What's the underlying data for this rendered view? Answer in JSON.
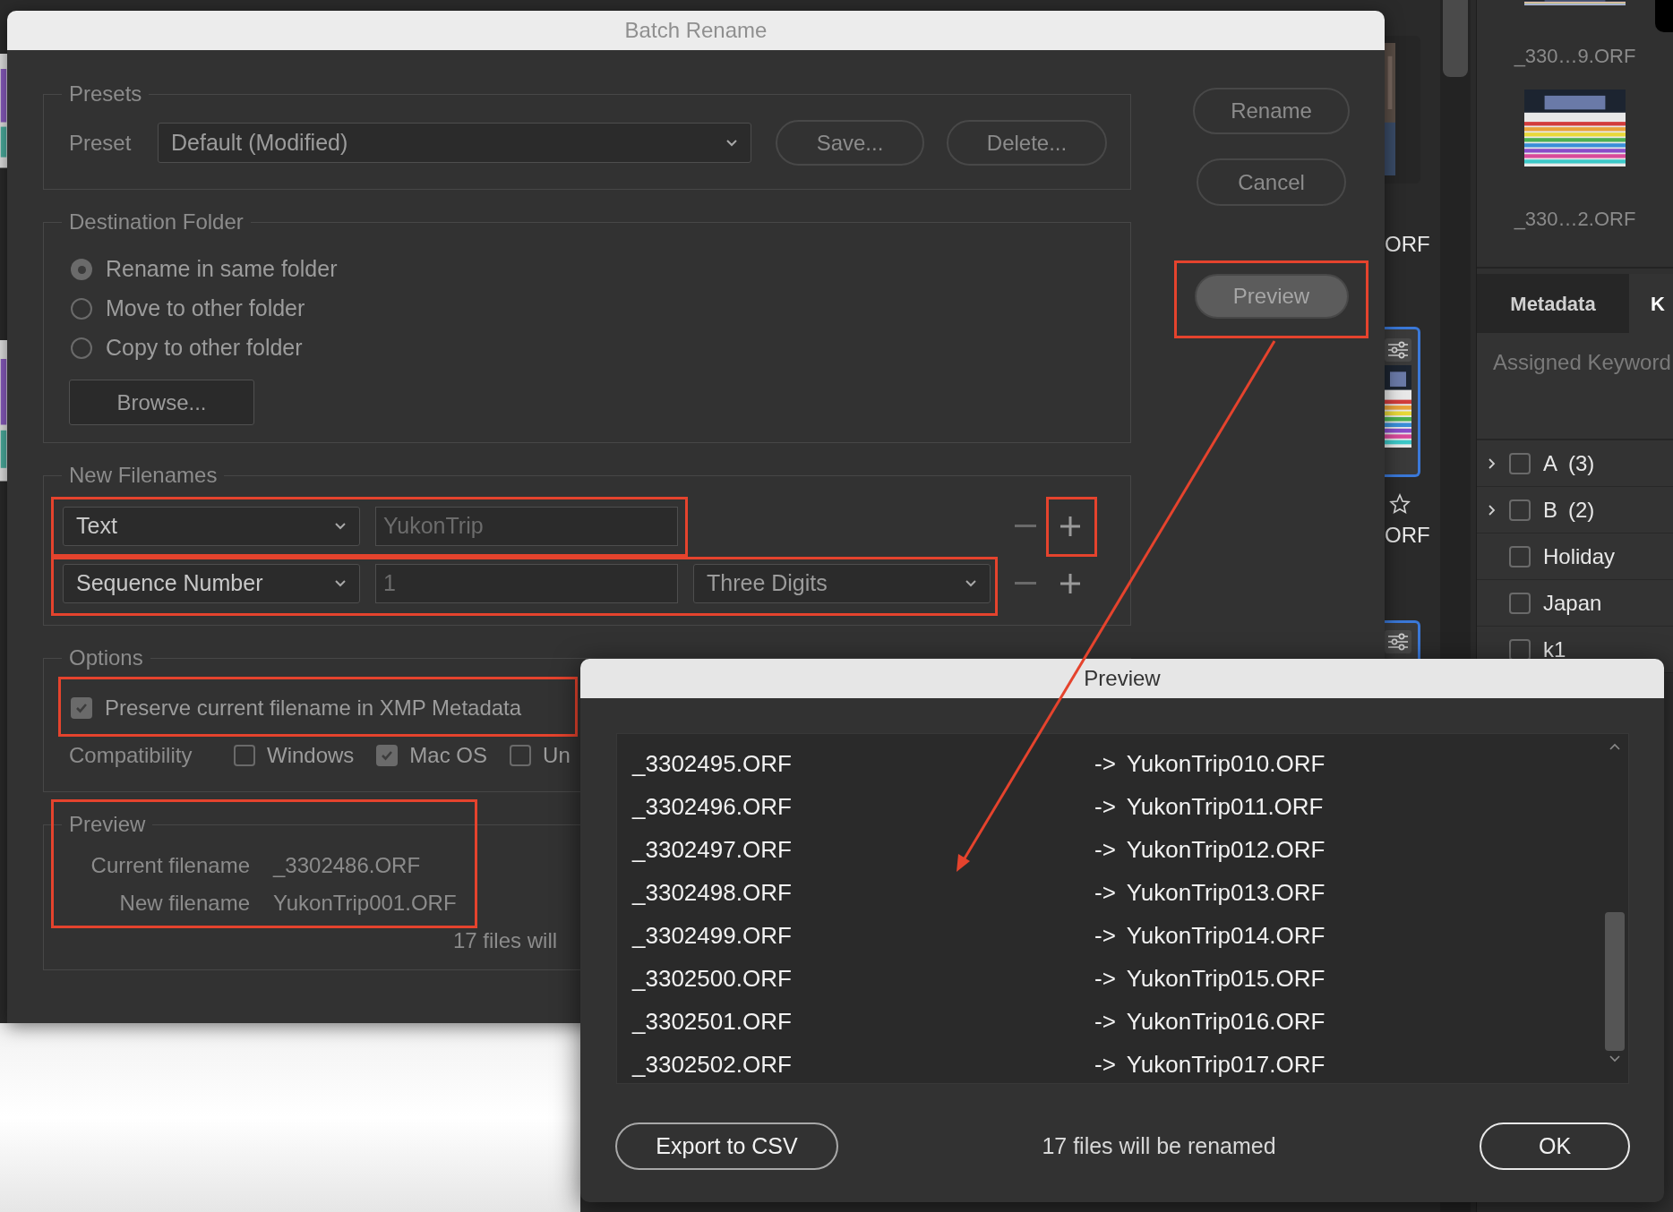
{
  "batch_rename": {
    "title": "Batch Rename",
    "presets": {
      "legend": "Presets",
      "label": "Preset",
      "value": "Default (Modified)",
      "buttons": [
        "Save...",
        "Delete..."
      ]
    },
    "destination": {
      "legend": "Destination Folder",
      "options": [
        {
          "label": "Rename in same folder",
          "selected": true
        },
        {
          "label": "Move to other folder",
          "selected": false
        },
        {
          "label": "Copy to other folder",
          "selected": false
        }
      ],
      "browse": "Browse..."
    },
    "new_filenames": {
      "legend": "New Filenames",
      "rows": [
        {
          "type": "Text",
          "value": "YukonTrip"
        },
        {
          "type": "Sequence Number",
          "value": "1",
          "format": "Three Digits"
        }
      ]
    },
    "options": {
      "legend": "Options",
      "preserve": {
        "label": "Preserve current filename in XMP Metadata",
        "checked": true
      },
      "compatibility": {
        "label": "Compatibility",
        "systems": [
          {
            "label": "Windows",
            "checked": false
          },
          {
            "label": "Mac OS",
            "checked": true
          },
          {
            "label": "Un",
            "checked": false
          }
        ]
      }
    },
    "preview": {
      "legend": "Preview",
      "current_label": "Current filename",
      "current_value": "_3302486.ORF",
      "new_label": "New filename",
      "new_value": "YukonTrip001.ORF",
      "summary": "17 files will"
    },
    "actions": [
      {
        "label": "Rename",
        "disabled": false
      },
      {
        "label": "Cancel",
        "disabled": false
      },
      {
        "label": "Preview",
        "disabled": true
      }
    ]
  },
  "preview_dialog": {
    "title": "Preview",
    "rows": [
      {
        "old": "_3302495.ORF",
        "arrow": "->",
        "new": "YukonTrip010.ORF"
      },
      {
        "old": "_3302496.ORF",
        "arrow": "->",
        "new": "YukonTrip011.ORF"
      },
      {
        "old": "_3302497.ORF",
        "arrow": "->",
        "new": "YukonTrip012.ORF"
      },
      {
        "old": "_3302498.ORF",
        "arrow": "->",
        "new": "YukonTrip013.ORF"
      },
      {
        "old": "_3302499.ORF",
        "arrow": "->",
        "new": "YukonTrip014.ORF"
      },
      {
        "old": "_3302500.ORF",
        "arrow": "->",
        "new": "YukonTrip015.ORF"
      },
      {
        "old": "_3302501.ORF",
        "arrow": "->",
        "new": "YukonTrip016.ORF"
      },
      {
        "old": "_3302502.ORF",
        "arrow": "->",
        "new": "YukonTrip017.ORF"
      }
    ],
    "export": "Export to CSV",
    "summary": "17 files will be renamed",
    "ok": "OK"
  },
  "browser": {
    "thumbnails": [
      {
        "label": "_330…9.ORF"
      },
      {
        "label": "_330…2.ORF"
      }
    ],
    "fragments": [
      "ORF",
      "ORF"
    ],
    "tabs": [
      {
        "label": "Metadata",
        "selected": false
      },
      {
        "label": "K",
        "selected": true
      }
    ],
    "keyword_placeholder": "Assigned Keyword",
    "keywords": [
      {
        "label": "A",
        "count": "(3)",
        "expandable": true,
        "checked": false
      },
      {
        "label": "B",
        "count": "(2)",
        "expandable": true,
        "checked": false
      },
      {
        "label": "Holiday",
        "expandable": false,
        "checked": false
      },
      {
        "label": "Japan",
        "expandable": false,
        "checked": false
      },
      {
        "label": "k1",
        "expandable": false,
        "checked": false
      }
    ]
  }
}
